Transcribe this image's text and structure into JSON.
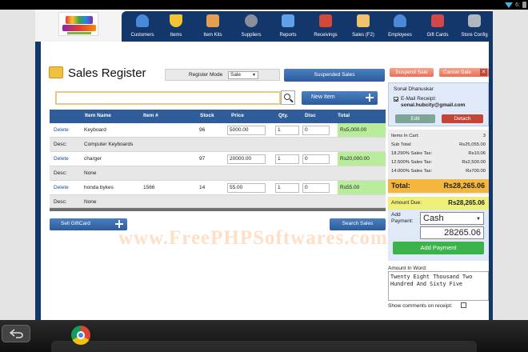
{
  "statusbar": {
    "time_partial": "6:"
  },
  "nav": {
    "items": [
      {
        "label": "Customers",
        "icon": "customers-icon",
        "color": "#4a88d8"
      },
      {
        "label": "Items",
        "icon": "items-icon",
        "color": "#f1c232"
      },
      {
        "label": "Item Kits",
        "icon": "item-kits-icon",
        "color": "#e0a050"
      },
      {
        "label": "Suppliers",
        "icon": "suppliers-icon",
        "color": "#8a8f9a"
      },
      {
        "label": "Reports",
        "icon": "reports-icon",
        "color": "#5fa0e8"
      },
      {
        "label": "Receivings",
        "icon": "receivings-icon",
        "color": "#d0493a"
      },
      {
        "label": "Sales (F2)",
        "icon": "sales-icon",
        "color": "#f0c36d"
      },
      {
        "label": "Employees",
        "icon": "employees-icon",
        "color": "#4a88d8"
      },
      {
        "label": "Gift Cards",
        "icon": "gift-cards-icon",
        "color": "#d04848"
      },
      {
        "label": "Store Config",
        "icon": "store-config-icon",
        "color": "#b0b6c0"
      }
    ]
  },
  "page": {
    "title": "Sales Register"
  },
  "register_mode": {
    "label": "Register Mode",
    "value": "Sale"
  },
  "buttons": {
    "suspended_sales": "Suspended Sales",
    "new_item": "New Item",
    "sell_giftcard": "Sell GiftCard",
    "search_sales": "Search Sales",
    "suspend_sale": "Suspend Sale",
    "cancel_sale": "Cancel Sale",
    "edit": "Edit",
    "detach": "Detach",
    "add_payment": "Add Payment"
  },
  "cart": {
    "headers": [
      "Item Name",
      "Item #",
      "Stock",
      "Price",
      "Qty.",
      "Disc",
      "Total"
    ],
    "items": [
      {
        "action": "Delete",
        "name": "Keyboard",
        "number": "",
        "stock": "96",
        "price": "5000.00",
        "qty": "1",
        "disc": "0",
        "total": "Rs5,000.00",
        "desc_label": "Desc:",
        "desc": "Computer Keyboards"
      },
      {
        "action": "Delete",
        "name": "charger",
        "number": "",
        "stock": "97",
        "price": "20000.00",
        "qty": "1",
        "disc": "0",
        "total": "Rs20,000.00",
        "desc_label": "Desc:",
        "desc": "None"
      },
      {
        "action": "Delete",
        "name": "honda bykes",
        "number": "1566",
        "stock": "14",
        "price": "55.00",
        "qty": "1",
        "disc": "0",
        "total": "Rs55.00",
        "desc_label": "Desc:",
        "desc": "None"
      }
    ]
  },
  "customer": {
    "name": "Sonal Dhanuskar",
    "email_receipt_label": "E-Mail Receipt:",
    "email_receipt_checked": true,
    "email": "sonal.hubcity@gmail.com"
  },
  "summary": {
    "rows": [
      {
        "label": "Items In Cart:",
        "value": "3"
      },
      {
        "label": "Sub Total:",
        "value": "Rs25,055.00"
      },
      {
        "label": "18.290% Sales Tax:",
        "value": "Rs10.06"
      },
      {
        "label": "12.500% Sales Tax:",
        "value": "Rs2,500.00"
      },
      {
        "label": "14.000% Sales Tax:",
        "value": "Rs700.00"
      }
    ],
    "total_label": "Total:",
    "total_value": "Rs28,265.06"
  },
  "payment": {
    "amount_due_label": "Amount Due:",
    "amount_due_value": "Rs28,265.06",
    "add_payment_label": "Add Payment:",
    "payment_type": "Cash",
    "amount": "28265.06"
  },
  "amount_in_word": {
    "label": "Amount In Word:",
    "value": "Twenty Eight Thousand Two Hundred And Sixty Five"
  },
  "show_comments": {
    "label": "Show comments on receipt:",
    "checked": false
  },
  "watermark": {
    "text": "www.FreePHPSoftwares.com"
  }
}
